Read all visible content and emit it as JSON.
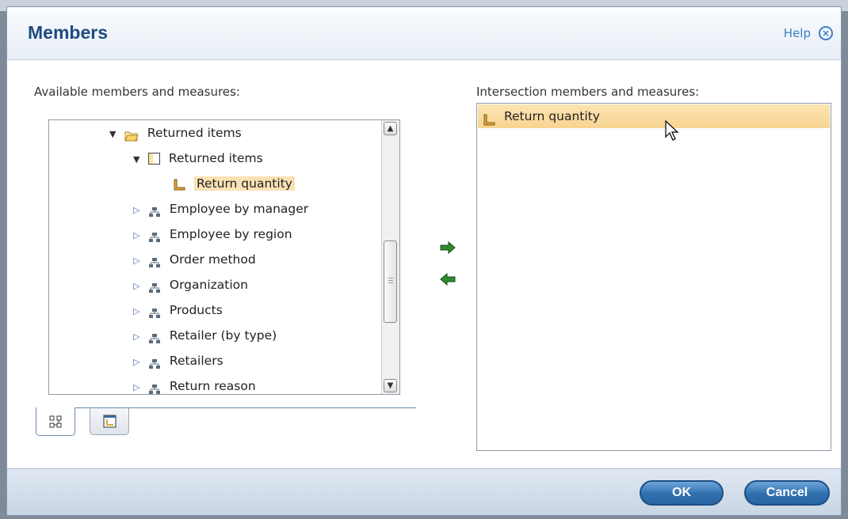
{
  "dialog": {
    "title": "Members",
    "help_label": "Help",
    "close_glyph": "×"
  },
  "left_panel": {
    "label": "Available members and measures:",
    "tree": [
      {
        "label": "Returned items",
        "icon": "folder-icon",
        "expanded": true
      },
      {
        "label": "Returned items",
        "icon": "cube-icon",
        "expanded": true
      },
      {
        "label": "Return quantity",
        "icon": "measure-icon",
        "selected": true
      },
      {
        "label": "Employee by manager",
        "icon": "hierarchy-icon",
        "expanded": false
      },
      {
        "label": "Employee by region",
        "icon": "hierarchy-icon",
        "expanded": false
      },
      {
        "label": "Order method",
        "icon": "hierarchy-icon",
        "expanded": false
      },
      {
        "label": "Organization",
        "icon": "hierarchy-icon",
        "expanded": false
      },
      {
        "label": "Products",
        "icon": "hierarchy-icon",
        "expanded": false
      },
      {
        "label": "Retailer (by type)",
        "icon": "hierarchy-icon",
        "expanded": false
      },
      {
        "label": "Retailers",
        "icon": "hierarchy-icon",
        "expanded": false
      },
      {
        "label": "Return reason",
        "icon": "hierarchy-icon",
        "expanded": false
      }
    ],
    "tabs": [
      {
        "icon": "source-tree-icon",
        "active": true
      },
      {
        "icon": "package-icon",
        "active": false
      }
    ]
  },
  "transfer": {
    "add_icon": "arrow-right-icon",
    "remove_icon": "arrow-left-icon",
    "accent": "#2e8b2e"
  },
  "right_panel": {
    "label": "Intersection members and measures:",
    "items": [
      {
        "label": "Return quantity",
        "icon": "measure-icon",
        "selected": true
      }
    ]
  },
  "footer": {
    "ok_label": "OK",
    "cancel_label": "Cancel"
  },
  "colors": {
    "title": "#1e4b80",
    "link": "#3d7ec2",
    "selection": "#fbe2b4",
    "button": "#2f6fae"
  }
}
